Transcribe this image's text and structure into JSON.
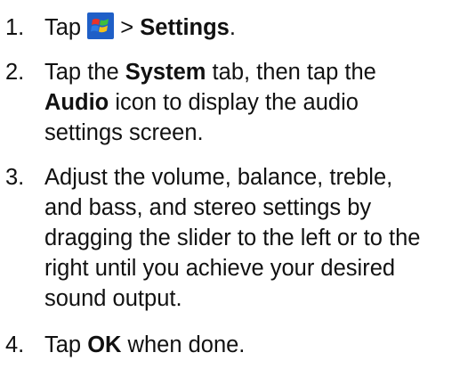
{
  "steps": [
    {
      "number": "1.",
      "before_icon": "Tap ",
      "icon": "windows-start-icon",
      "after_icon": " > ",
      "bold": "Settings",
      "end": "."
    },
    {
      "number": "2.",
      "l1_a": "Tap the ",
      "l1_b": "System",
      "l1_c": " tab, then tap the",
      "l2_a": "Audio",
      "l2_b": " icon to display the audio",
      "l3": "settings screen."
    },
    {
      "number": "3.",
      "lines": [
        "Adjust the volume, balance, treble,",
        "and bass, and stereo settings by",
        "dragging the slider to the left or to the",
        "right until you achieve your desired",
        "sound output."
      ]
    },
    {
      "number": "4.",
      "a": "Tap ",
      "b": "OK",
      "c": " when done."
    }
  ]
}
